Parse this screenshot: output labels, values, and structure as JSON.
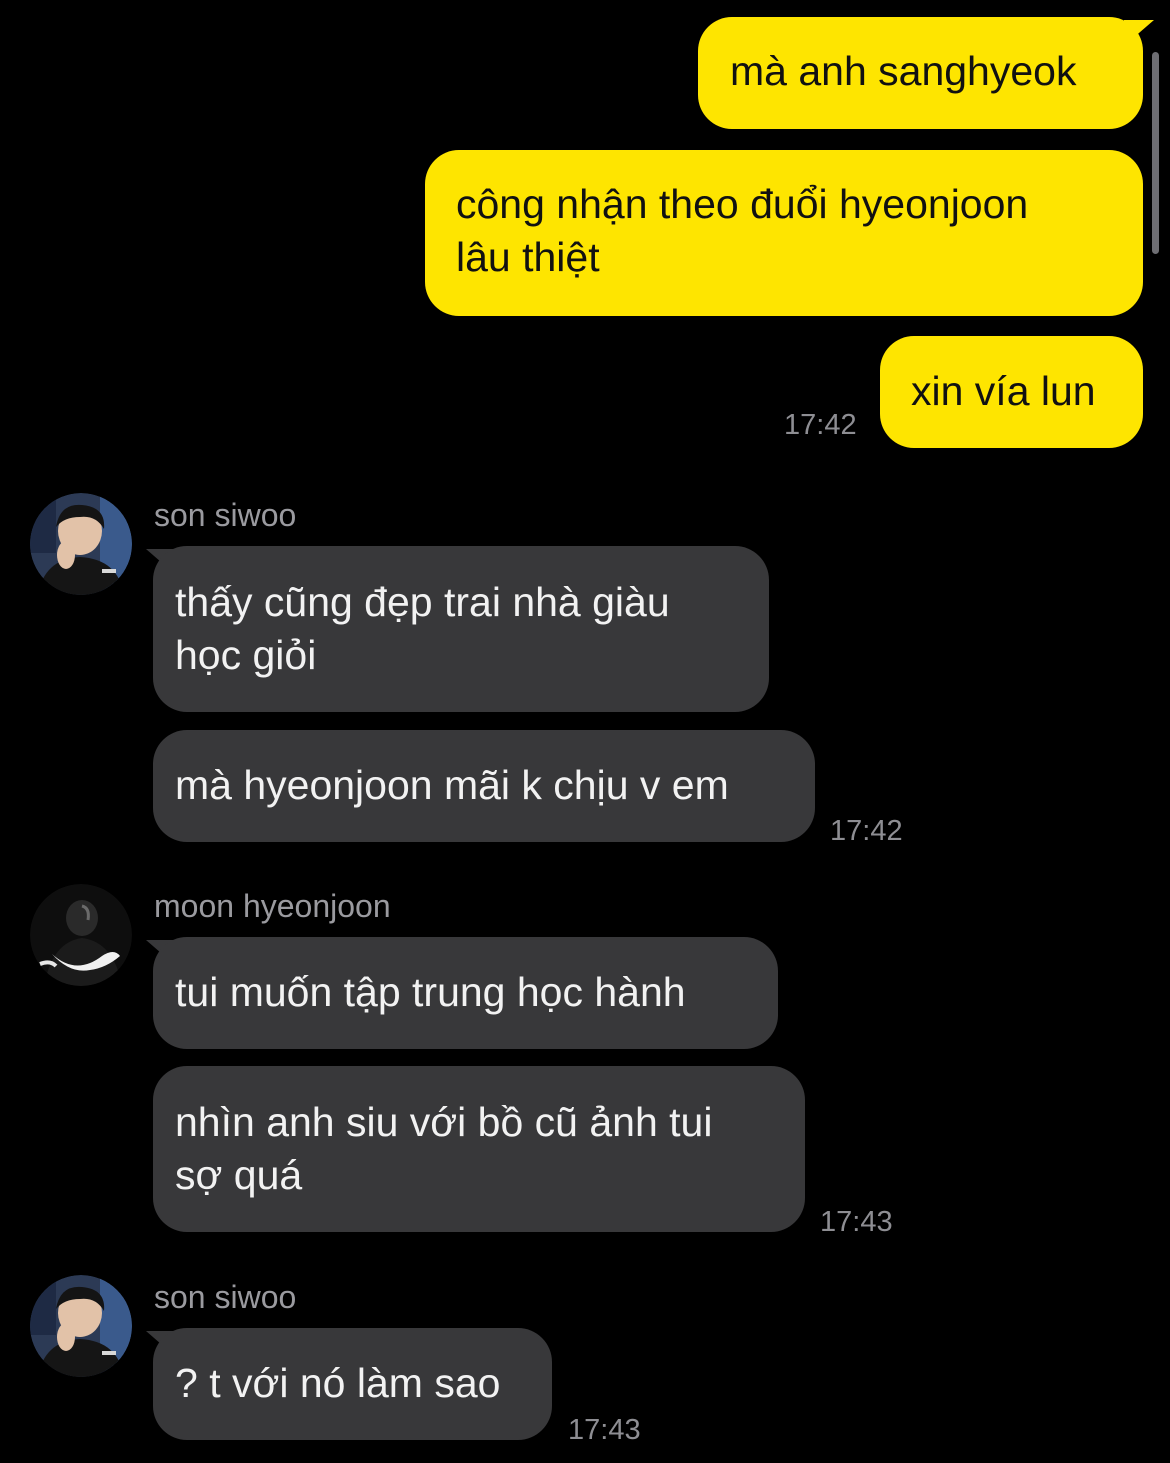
{
  "colors": {
    "background": "#000000",
    "outgoing_bubble": "#FEE500",
    "incoming_bubble": "#38383A",
    "timestamp": "#8E8E93",
    "sender_name": "#9A9A9F"
  },
  "outgoing": {
    "messages": [
      {
        "lines": [
          "mà anh sanghyeok"
        ]
      },
      {
        "lines": [
          "công nhận theo đuổi hyeonjoon",
          "lâu thiệt"
        ]
      },
      {
        "lines": [
          "xin vía lun"
        ]
      }
    ],
    "time": "17:42"
  },
  "groups": [
    {
      "sender": "son siwoo",
      "avatar_icon": "user-avatar-icon",
      "messages": [
        {
          "lines": [
            "thấy cũng đẹp trai nhà giàu",
            "học giỏi"
          ]
        },
        {
          "lines": [
            "mà hyeonjoon mãi k chịu v em"
          ]
        }
      ],
      "time": "17:42"
    },
    {
      "sender": "moon hyeonjoon",
      "avatar_icon": "user-avatar-icon",
      "messages": [
        {
          "lines": [
            "tui muốn tập trung học hành"
          ]
        },
        {
          "lines": [
            "nhìn anh siu với bồ cũ ảnh tui",
            "sợ quá"
          ]
        }
      ],
      "time": "17:43"
    },
    {
      "sender": "son siwoo",
      "avatar_icon": "user-avatar-icon",
      "messages": [
        {
          "lines": [
            "? t với nó làm sao"
          ]
        }
      ],
      "time": "17:43"
    }
  ]
}
